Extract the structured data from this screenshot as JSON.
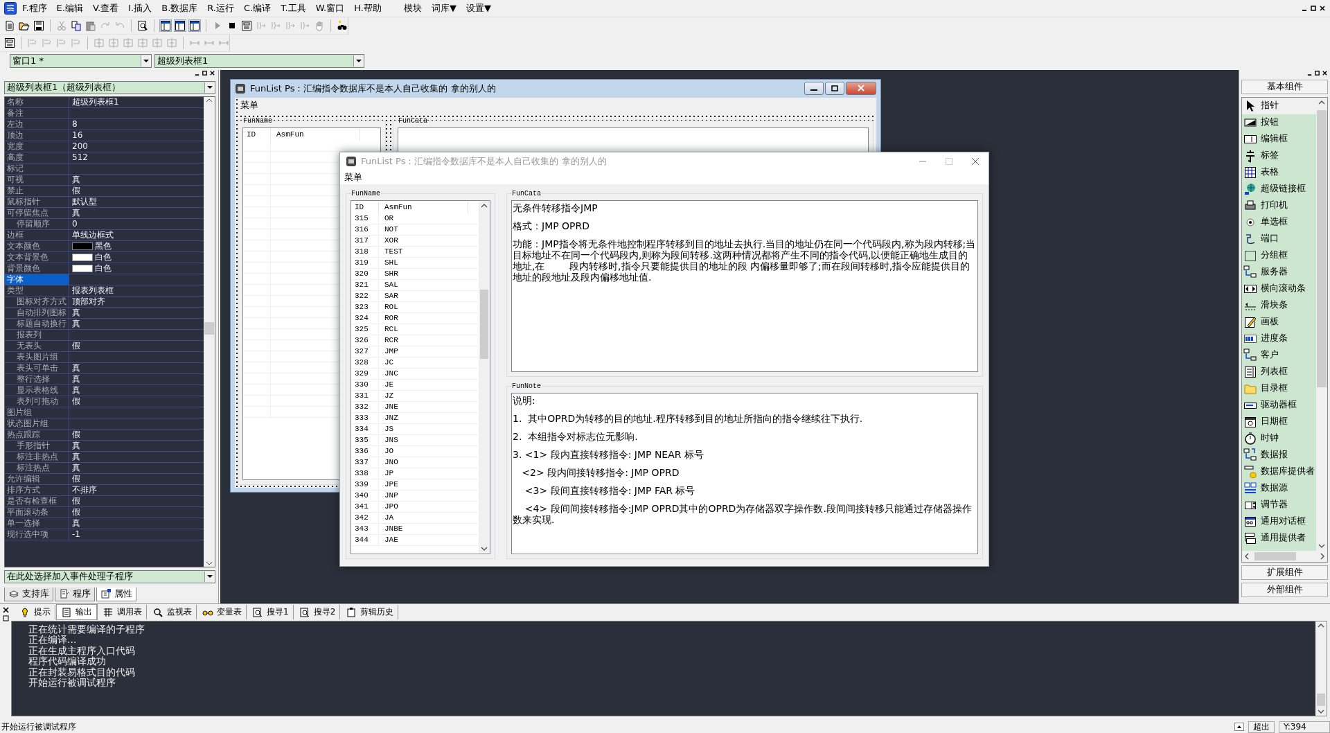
{
  "menu": [
    "F.程序",
    "E.编辑",
    "V.查看",
    "I.插入",
    "B.数据库",
    "R.运行",
    "C.编译",
    "T.工具",
    "W.窗口",
    "H.帮助",
    "模块",
    "词库▼",
    "设置▼"
  ],
  "combos": {
    "window": "窗口1 *",
    "control": "超级列表框1"
  },
  "properties": {
    "object": "超级列表框1（超级列表框）",
    "rows": [
      {
        "name": "名称",
        "value": "超级列表框1",
        "selected": false
      },
      {
        "name": "备注",
        "selected": false
      },
      {
        "name": "左边",
        "value": "8",
        "selected": false
      },
      {
        "name": "顶边",
        "value": "16",
        "selected": false
      },
      {
        "name": "宽度",
        "value": "200",
        "selected": false
      },
      {
        "name": "高度",
        "value": "512",
        "selected": false
      },
      {
        "name": "标记",
        "selected": false
      },
      {
        "name": "可视",
        "value": "真",
        "selected": false
      },
      {
        "name": "禁止",
        "value": "假",
        "selected": false
      },
      {
        "name": "鼠标指针",
        "value": "默认型",
        "selected": false
      },
      {
        "name": "可停留焦点",
        "value": "真",
        "selected": false,
        "children": [
          {
            "name": "停留顺序",
            "value": "0",
            "selected": false
          }
        ]
      },
      {
        "name": "边框",
        "value": "单线边框式",
        "selected": false
      },
      {
        "name": "文本颜色",
        "value": "黑色",
        "color": "#000000",
        "selected": false
      },
      {
        "name": "文本背景色",
        "value": "白色",
        "color": "#ffffff",
        "selected": false
      },
      {
        "name": "背景颜色",
        "value": "白色",
        "color": "#ffffff",
        "selected": false
      },
      {
        "name": "字体",
        "selected": true
      },
      {
        "name": "类型",
        "value": "报表列表框",
        "selected": false,
        "children": [
          {
            "name": "图标对齐方式",
            "value": "顶部对齐",
            "selected": false
          },
          {
            "name": "自动排列图标",
            "value": "真",
            "selected": false
          },
          {
            "name": "标题自动换行",
            "value": "真",
            "selected": false
          },
          {
            "name": "报表列",
            "selected": false
          },
          {
            "name": "无表头",
            "value": "假",
            "selected": false
          },
          {
            "name": "表头图片组",
            "selected": false
          },
          {
            "name": "表头可单击",
            "value": "真",
            "selected": false
          },
          {
            "name": "整行选择",
            "value": "真",
            "selected": false
          },
          {
            "name": "显示表格线",
            "value": "真",
            "selected": false
          },
          {
            "name": "表列可拖动",
            "value": "假",
            "selected": false
          }
        ]
      },
      {
        "name": "图片组",
        "selected": false
      },
      {
        "name": "状态图片组",
        "selected": false
      },
      {
        "name": "热点跟踪",
        "value": "假",
        "selected": false,
        "children": [
          {
            "name": "手形指针",
            "value": "真",
            "selected": false
          },
          {
            "name": "标注非热点",
            "value": "真",
            "selected": false
          },
          {
            "name": "标注热点",
            "value": "真",
            "selected": false
          }
        ]
      },
      {
        "name": "允许编辑",
        "value": "假",
        "selected": false
      },
      {
        "name": "排序方式",
        "value": "不排序",
        "selected": false
      },
      {
        "name": "是否有检查框",
        "value": "假",
        "selected": false
      },
      {
        "name": "平面滚动条",
        "value": "假",
        "selected": false
      },
      {
        "name": "单一选择",
        "value": "真",
        "selected": false
      },
      {
        "name": "现行选中项",
        "value": "-1",
        "selected": false
      }
    ],
    "event_combo": "在此处选择加入事件处理子程序",
    "tabs": [
      {
        "label": "支持库",
        "selected": false
      },
      {
        "label": "程序",
        "selected": false
      },
      {
        "label": "属性",
        "selected": true
      }
    ]
  },
  "designer_window": {
    "title": "FunList Ps：汇编指令数据库不是本人自己收集的 拿的别人的",
    "menu": "菜单",
    "list_group": "FunName",
    "columns": [
      "ID",
      "AsmFun"
    ],
    "text_group": "FunCata"
  },
  "run_window": {
    "title": "FunList Ps：汇编指令数据库不是本人自己收集的 拿的别人的",
    "menu": "菜单",
    "list_group": "FunName",
    "columns": [
      "ID",
      "AsmFun"
    ],
    "rows": [
      {
        "id": "315",
        "asm": "OR"
      },
      {
        "id": "316",
        "asm": "NOT"
      },
      {
        "id": "317",
        "asm": "XOR"
      },
      {
        "id": "318",
        "asm": "TEST"
      },
      {
        "id": "319",
        "asm": "SHL"
      },
      {
        "id": "320",
        "asm": "SHR"
      },
      {
        "id": "321",
        "asm": "SAL"
      },
      {
        "id": "322",
        "asm": "SAR"
      },
      {
        "id": "323",
        "asm": "ROL"
      },
      {
        "id": "324",
        "asm": "ROR"
      },
      {
        "id": "325",
        "asm": "RCL"
      },
      {
        "id": "326",
        "asm": "RCR"
      },
      {
        "id": "327",
        "asm": "JMP"
      },
      {
        "id": "328",
        "asm": "JC"
      },
      {
        "id": "329",
        "asm": "JNC"
      },
      {
        "id": "330",
        "asm": "JE"
      },
      {
        "id": "331",
        "asm": "JZ"
      },
      {
        "id": "332",
        "asm": "JNE"
      },
      {
        "id": "333",
        "asm": "JNZ"
      },
      {
        "id": "334",
        "asm": "JS"
      },
      {
        "id": "335",
        "asm": "JNS"
      },
      {
        "id": "336",
        "asm": "JO"
      },
      {
        "id": "337",
        "asm": "JNO"
      },
      {
        "id": "338",
        "asm": "JP"
      },
      {
        "id": "339",
        "asm": "JPE"
      },
      {
        "id": "340",
        "asm": "JNP"
      },
      {
        "id": "341",
        "asm": "JPO"
      },
      {
        "id": "342",
        "asm": "JA"
      },
      {
        "id": "343",
        "asm": "JNBE"
      },
      {
        "id": "344",
        "asm": "JAE"
      }
    ],
    "cata_group": "FunCata",
    "cata_lines": [
      "无条件转移指令JMP",
      "格式：JMP OPRD",
      "功能：JMP指令将无条件地控制程序转移到目的地址去执行.当目的地址仍在同一个代码段内,称为段内转移;当目标地址不在同一个代码段内,则称为段间转移.这两种情况都将产生不同的指令代码,以便能正确地生成目的地址,在        段内转移时,指令只要能提供目的地址的段 内偏移量即够了;而在段间转移时,指令应能提供目的地址的段地址及段内偏移地址值."
    ],
    "note_group": "FunNote",
    "note_lines": [
      "说明:",
      "1.  其中OPRD为转移的目的地址.程序转移到目的地址所指向的指令继续往下执行.",
      "2.  本组指令对标志位无影响.",
      "3. <1> 段内直接转移指令: JMP NEAR 标号",
      "   <2> 段内间接转移指令: JMP OPRD",
      "    <3> 段间直接转移指令: JMP FAR 标号",
      "    <4> 段间间接转移指令:JMP OPRD其中的OPRD为存储器双字操作数.段间间接转移只能通过存储器操作数来实现."
    ]
  },
  "toolbox": {
    "header": "基本组件",
    "items": [
      {
        "label": "指针",
        "selected": true
      },
      {
        "label": "按钮",
        "selected": false
      },
      {
        "label": "编辑框",
        "selected": false
      },
      {
        "label": "标签",
        "selected": false
      },
      {
        "label": "表格",
        "selected": false
      },
      {
        "label": "超级链接框",
        "selected": false
      },
      {
        "label": "打印机",
        "selected": false
      },
      {
        "label": "单选框",
        "selected": false
      },
      {
        "label": "端口",
        "selected": false
      },
      {
        "label": "分组框",
        "selected": false
      },
      {
        "label": "服务器",
        "selected": false
      },
      {
        "label": "横向滚动条",
        "selected": false
      },
      {
        "label": "滑块条",
        "selected": false
      },
      {
        "label": "画板",
        "selected": false
      },
      {
        "label": "进度条",
        "selected": false
      },
      {
        "label": "客户",
        "selected": false
      },
      {
        "label": "列表框",
        "selected": false
      },
      {
        "label": "目录框",
        "selected": false
      },
      {
        "label": "驱动器框",
        "selected": false
      },
      {
        "label": "日期框",
        "selected": false
      },
      {
        "label": "时钟",
        "selected": false
      },
      {
        "label": "数据报",
        "selected": false
      },
      {
        "label": "数据库提供者",
        "selected": false
      },
      {
        "label": "数据源",
        "selected": false
      },
      {
        "label": "调节器",
        "selected": false
      },
      {
        "label": "通用对话框",
        "selected": false
      },
      {
        "label": "通用提供者",
        "selected": false
      }
    ],
    "footer_buttons": [
      "扩展组件",
      "外部组件"
    ]
  },
  "output": {
    "tabs": [
      {
        "label": "提示",
        "selected": false
      },
      {
        "label": "输出",
        "selected": true
      },
      {
        "label": "调用表",
        "selected": false
      },
      {
        "label": "监视表",
        "selected": false
      },
      {
        "label": "变量表",
        "selected": false
      },
      {
        "label": "搜寻1",
        "selected": false
      },
      {
        "label": "搜寻2",
        "selected": false
      },
      {
        "label": "剪辑历史",
        "selected": false
      }
    ],
    "lines": [
      "正在统计需要编译的子程序",
      "正在编译...",
      "正在生成主程序入口代码",
      "程序代码编译成功",
      "正在封装易格式目的代码",
      "开始运行被调试程序"
    ]
  },
  "status_bar": {
    "message": "开始运行被调试程序",
    "mode": "超出",
    "position": "Y:394"
  }
}
